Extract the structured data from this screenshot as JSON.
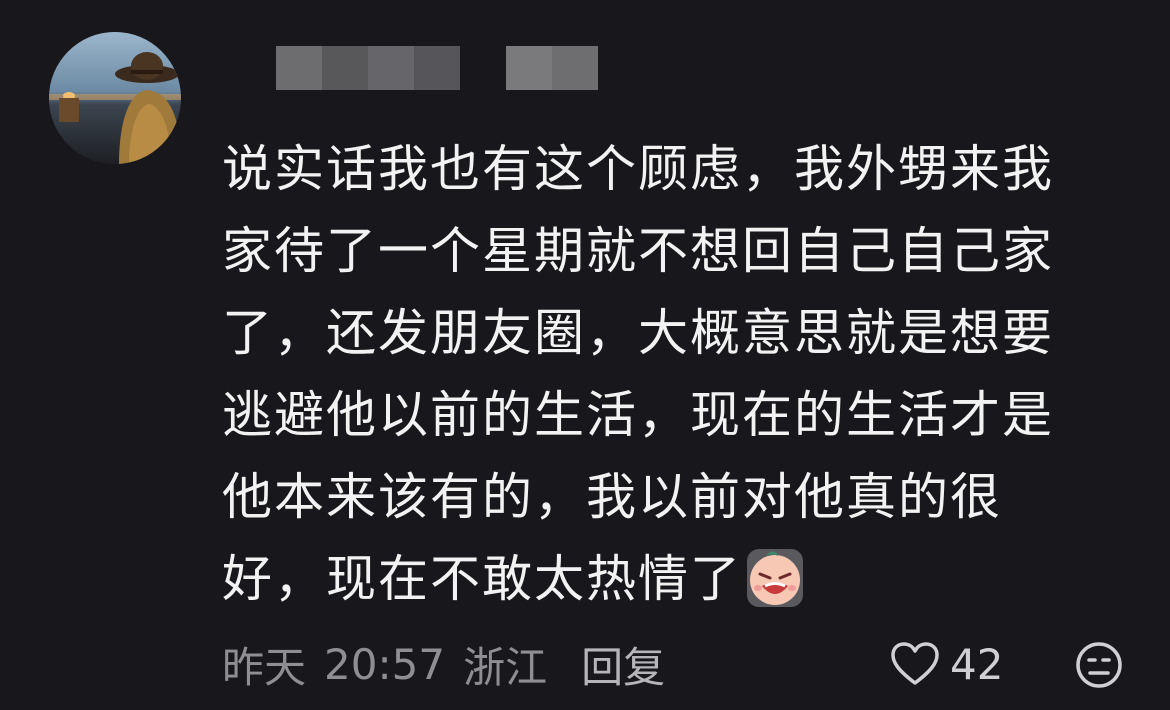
{
  "comment": {
    "avatar": "user-avatar",
    "username_redacted": true,
    "text_lines": [
      "说实话我也有这个顾虑，我外甥来我",
      "家待了一个星期就不想回自己自己家",
      "了，还发朋友圈，大概意思就是想要",
      "逃避他以前的生活，现在的生活才是",
      "他本来该有的，我以前对他真的很",
      "好，现在不敢太热情了"
    ],
    "emoji": "crying-face-emoji",
    "date": "昨天",
    "time": "20:57",
    "location": "浙江",
    "reply_label": "回复",
    "like_count": "42",
    "icons": {
      "like": "heart-outline-icon",
      "dislike": "unhappy-face-icon"
    }
  },
  "colors": {
    "background": "#18181c",
    "text": "#f2f2f2",
    "meta": "#8f8f93"
  }
}
